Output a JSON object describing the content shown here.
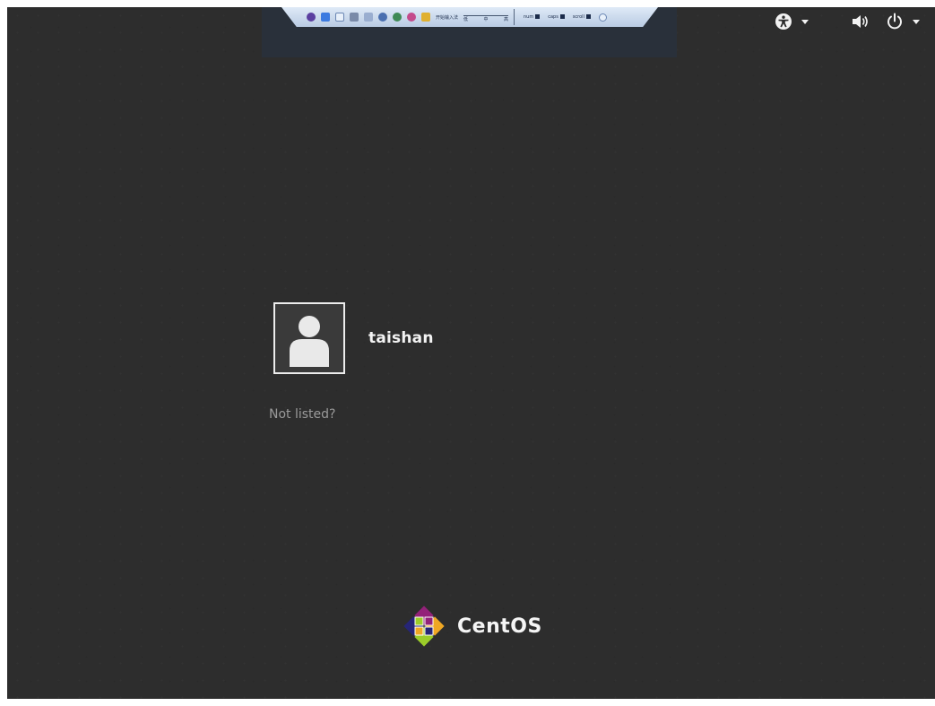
{
  "toolbar": {
    "keyboard_label": "开始输入法",
    "slider_marks": [
      "低",
      "中",
      "高"
    ],
    "indicators": {
      "num": "num",
      "caps": "caps",
      "scroll": "scroll"
    }
  },
  "system": {
    "accessibility_icon": "accessibility-icon",
    "volume_icon": "volume-icon",
    "power_icon": "power-icon"
  },
  "login": {
    "user_name": "taishan",
    "not_listed_label": "Not listed?"
  },
  "branding": {
    "name": "CentOS"
  },
  "colors": {
    "background": "#2d2d2d",
    "text": "#f3f3f3",
    "muted_text": "#9a9a9a",
    "avatar_border": "#ededed"
  }
}
